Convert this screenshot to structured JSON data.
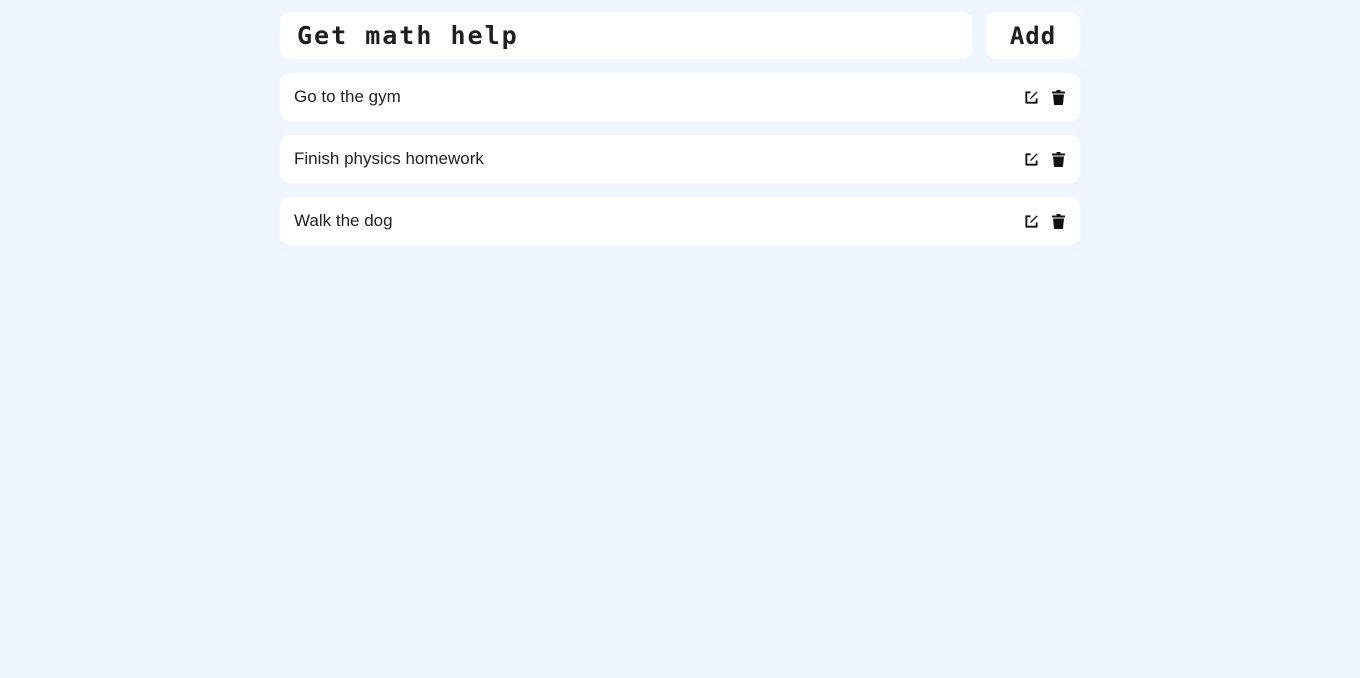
{
  "form": {
    "input_value": "Get math help",
    "add_label": "Add"
  },
  "tasks": [
    {
      "text": "Go to the gym",
      "edit_icon": "edit-icon",
      "delete_icon": "trash-icon"
    },
    {
      "text": "Finish physics homework",
      "edit_icon": "edit-icon",
      "delete_icon": "trash-icon"
    },
    {
      "text": "Walk the dog",
      "edit_icon": "edit-icon",
      "delete_icon": "trash-icon"
    }
  ],
  "colors": {
    "background": "#eff6ff",
    "card": "#ffffff",
    "text": "#222222"
  }
}
